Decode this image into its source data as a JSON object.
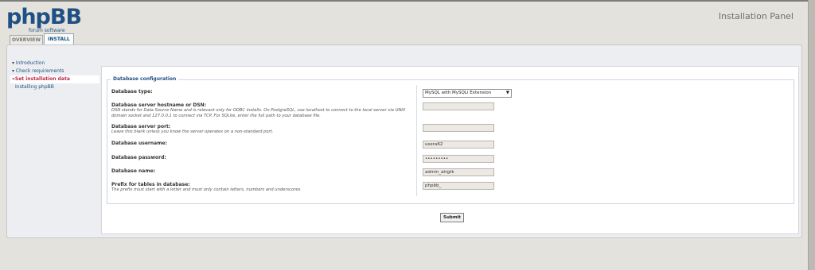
{
  "header": {
    "logo_text": "phpBB",
    "logo_tagline": "forum  software",
    "panel_title": "Installation Panel"
  },
  "tabs": [
    {
      "label": "OVERVIEW"
    },
    {
      "label": "INSTALL"
    }
  ],
  "menu": [
    {
      "label": "▾ Introduction"
    },
    {
      "label": "▾ Check requirements"
    },
    {
      "label": "»Set installation data"
    },
    {
      "label": "Installing phpBB"
    }
  ],
  "form": {
    "legend": "Database configuration",
    "db_type": {
      "label": "Database type:",
      "value": "MySQL with MySQLi Extension"
    },
    "hostname": {
      "label": "Database server hostname or DSN:",
      "desc": "DSN stands for Data Source Name and is relevant only for ODBC installs. On PostgreSQL, use localhost to connect to the local server via UNIX domain socket and 127.0.0.1 to connect via TCP. For SQLite, enter the full path to your database file.",
      "value": ""
    },
    "port": {
      "label": "Database server port:",
      "desc": "Leave this blank unless you know the server operates on a non-standard port.",
      "value": ""
    },
    "username": {
      "label": "Database username:",
      "value": "usera62"
    },
    "password": {
      "label": "Database password:",
      "value": "•••••••••"
    },
    "dbname": {
      "label": "Database name:",
      "value": "admin_atrgtk"
    },
    "prefix": {
      "label": "Prefix for tables in database:",
      "desc": "The prefix must start with a letter and must only contain letters, numbers and underscores.",
      "value": "phpbb_"
    },
    "submit_label": "Submit"
  }
}
